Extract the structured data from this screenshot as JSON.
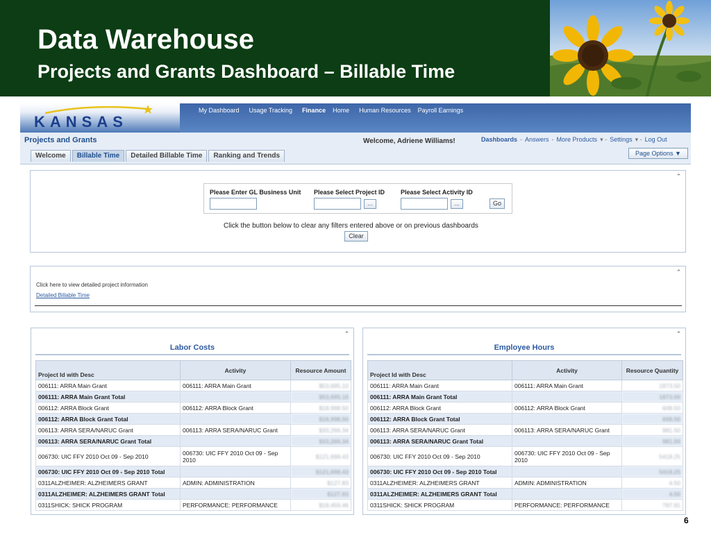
{
  "slide": {
    "title": "Data Warehouse",
    "subtitle": "Projects and Grants Dashboard – Billable Time",
    "page_number": "6"
  },
  "app": {
    "logo": "KANSAS",
    "global_nav": [
      "My Dashboard",
      "Usage Tracking",
      "Finance",
      "Home",
      "Human Resources",
      "Payroll Earnings"
    ],
    "active_nav": "Finance",
    "dashboard_name": "Projects and Grants",
    "welcome": "Welcome, Adriene Williams!",
    "top_links": [
      "Dashboards",
      "Answers",
      "More Products",
      "Settings",
      "Log Out"
    ],
    "page_options": "Page Options ▼",
    "tabs": [
      "Welcome",
      "Billable Time",
      "Detailed Billable Time",
      "Ranking and Trends"
    ],
    "active_tab": "Billable Time"
  },
  "prompts": {
    "business_unit_label": "Please Enter GL Business Unit",
    "project_label": "Please Select Project ID",
    "activity_label": "Please Select Activity ID",
    "ellipsis": "...",
    "go": "Go",
    "clear_hint": "Click the button below to clear any filters entered above or on previous dashboards",
    "clear": "Clear"
  },
  "link_panel": {
    "hint": "Click here to view detailed project information",
    "link": "Detailed Billable Time"
  },
  "labor_costs": {
    "title": "Labor Costs",
    "headers": [
      "Project Id with Desc",
      "Activity",
      "Resource Amount"
    ],
    "rows": [
      {
        "project": "006111: ARRA Main Grant",
        "activity": "006111: ARRA Main Grant",
        "value": "$53,695.10",
        "total": false
      },
      {
        "project": "006111: ARRA Main Grant Total",
        "activity": "",
        "value": "$53,695.10",
        "total": true
      },
      {
        "project": "006112: ARRA Block Grant",
        "activity": "006112: ARRA Block Grant",
        "value": "$18,998.50",
        "total": false
      },
      {
        "project": "006112: ARRA Block Grant Total",
        "activity": "",
        "value": "$18,998.50",
        "total": true
      },
      {
        "project": "006113: ARRA SERA/NARUC Grant",
        "activity": "006113: ARRA SERA/NARUC Grant",
        "value": "$33,266.34",
        "total": false
      },
      {
        "project": "006113: ARRA SERA/NARUC Grant Total",
        "activity": "",
        "value": "$33,266.34",
        "total": true
      },
      {
        "project": "006730: UIC FFY 2010 Oct 09 - Sep 2010",
        "activity": "006730: UIC FFY 2010 Oct 09 - Sep 2010",
        "value": "$121,698.43",
        "total": false,
        "tall": true
      },
      {
        "project": "006730: UIC FFY 2010 Oct 09 - Sep 2010 Total",
        "activity": "",
        "value": "$121,698.43",
        "total": true
      },
      {
        "project": "0311ALZHEIMER: ALZHEIMERS GRANT",
        "activity": "ADMIN: ADMINISTRATION",
        "value": "$127.83",
        "total": false
      },
      {
        "project": "0311ALZHEIMER: ALZHEIMERS GRANT Total",
        "activity": "",
        "value": "$127.83",
        "total": true
      },
      {
        "project": "0311SHICK: SHICK PROGRAM",
        "activity": "PERFORMANCE: PERFORMANCE",
        "value": "$18,459.46",
        "total": false
      }
    ]
  },
  "employee_hours": {
    "title": "Employee Hours",
    "headers": [
      "Project Id with Desc",
      "Activity",
      "Resource Quantity"
    ],
    "rows": [
      {
        "project": "006111: ARRA Main Grant",
        "activity": "006111: ARRA Main Grant",
        "value": "1873.50",
        "total": false
      },
      {
        "project": "006111: ARRA Main Grant Total",
        "activity": "",
        "value": "1873.50",
        "total": true
      },
      {
        "project": "006112: ARRA Block Grant",
        "activity": "006112: ARRA Block Grant",
        "value": "608.50",
        "total": false
      },
      {
        "project": "006112: ARRA Block Grant Total",
        "activity": "",
        "value": "608.50",
        "total": true
      },
      {
        "project": "006113: ARRA SERA/NARUC Grant",
        "activity": "006113: ARRA SERA/NARUC Grant",
        "value": "981.50",
        "total": false
      },
      {
        "project": "006113: ARRA SERA/NARUC Grant Total",
        "activity": "",
        "value": "981.50",
        "total": true
      },
      {
        "project": "006730: UIC FFY 2010 Oct 09 - Sep 2010",
        "activity": "006730: UIC FFY 2010 Oct 09 - Sep 2010",
        "value": "5418.25",
        "total": false,
        "tall": true
      },
      {
        "project": "006730: UIC FFY 2010 Oct 09 - Sep 2010 Total",
        "activity": "",
        "value": "5418.25",
        "total": true
      },
      {
        "project": "0311ALZHEIMER: ALZHEIMERS GRANT",
        "activity": "ADMIN: ADMINISTRATION",
        "value": "4.50",
        "total": false
      },
      {
        "project": "0311ALZHEIMER: ALZHEIMERS GRANT Total",
        "activity": "",
        "value": "4.50",
        "total": true
      },
      {
        "project": "0311SHICK: SHICK PROGRAM",
        "activity": "PERFORMANCE: PERFORMANCE",
        "value": "797.91",
        "total": false
      }
    ]
  },
  "colors": {
    "slide_header_bg": "#0c3d14",
    "link_blue": "#2c5aa0",
    "header_row": "#dde6f1",
    "total_row": "#e2eaf5"
  }
}
